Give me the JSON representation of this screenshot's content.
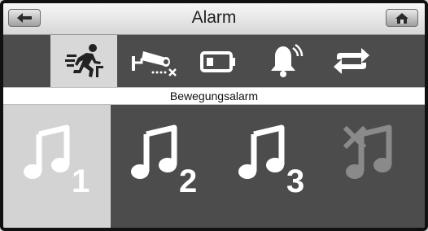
{
  "header": {
    "title": "Alarm",
    "back_icon": "back-arrow-icon",
    "home_icon": "home-icon"
  },
  "tabs": [
    {
      "icon": "running-man-icon",
      "active": true
    },
    {
      "icon": "camera-disconnected-icon",
      "active": false
    },
    {
      "icon": "battery-icon",
      "active": false
    },
    {
      "icon": "bell-ringing-icon",
      "active": false
    },
    {
      "icon": "repeat-arrows-icon",
      "active": false
    }
  ],
  "section": {
    "title": "Bewegungsalarm"
  },
  "tones": [
    {
      "icon": "music-note-icon",
      "label": "1",
      "active": true
    },
    {
      "icon": "music-note-icon",
      "label": "2",
      "active": false
    },
    {
      "icon": "music-note-icon",
      "label": "3",
      "active": false
    },
    {
      "icon": "music-note-muted-icon",
      "label": "",
      "muted": true,
      "active": false
    }
  ],
  "colors": {
    "panel_dark": "#4c4c4c",
    "selected": "#d8d8d8",
    "header_light": "#f7f7f7"
  }
}
